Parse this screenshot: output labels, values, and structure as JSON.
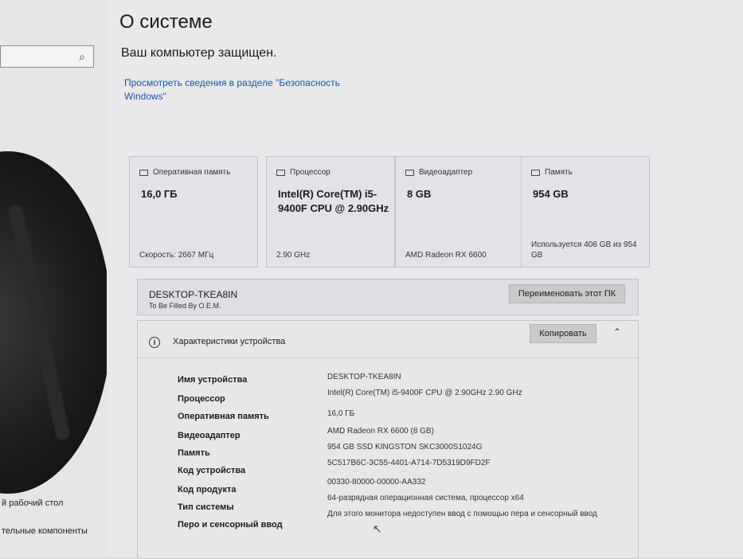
{
  "sidebar": {
    "items": [
      {
        "label": "й рабочий стол"
      },
      {
        "label": "тельные компоненты"
      }
    ]
  },
  "page": {
    "title": "О системе",
    "protected": "Ваш компьютер защищен.",
    "security_link": "Просмотреть сведения в разделе \"Безопасность Windows\""
  },
  "cards": [
    {
      "header": "Оперативная память",
      "value": "16,0 ГБ",
      "footer": "Скорость: 2667 МГц",
      "icon": "ram-icon"
    },
    {
      "header": "Процессор",
      "value": "Intel(R) Core(TM) i5-9400F CPU @ 2.90GHz",
      "footer": "2.90 GHz",
      "icon": "cpu-icon"
    },
    {
      "header": "Видеоадаптер",
      "value": "8 GB",
      "footer": "AMD Radeon RX 6600",
      "icon": "gpu-icon"
    },
    {
      "header": "Память",
      "value": "954 GB",
      "footer": "Используется 406 GB из 954 GB",
      "icon": "storage-icon"
    }
  ],
  "pc": {
    "name": "DESKTOP-TKEA8IN",
    "subtitle": "To Be Filled By O.E.M.",
    "rename_label": "Переименовать этот ПК"
  },
  "specs": {
    "title": "Характеристики устройства",
    "copy_label": "Копировать",
    "rows": [
      {
        "label": "Имя устройства",
        "value": "DESKTOP-TKEA8IN"
      },
      {
        "label": "Процессор",
        "value": "Intel(R) Core(TM) i5-9400F CPU @ 2.90GHz   2.90 GHz"
      },
      {
        "label": "Оперативная память",
        "value": "16,0 ГБ"
      },
      {
        "label": "Видеоадаптер",
        "value": "AMD Radeon RX 6600 (8 GB)"
      },
      {
        "label": "Память",
        "value": "954 GB SSD KINGSTON SKC3000S1024G"
      },
      {
        "label": "Код устройства",
        "value": "5C517B6C-3C55-4401-A714-7D5319D9FD2F"
      },
      {
        "label": "Код продукта",
        "value": "00330-80000-00000-AA332"
      },
      {
        "label": "Тип системы",
        "value": "64-разрядная операционная система, процессор x64"
      },
      {
        "label": "Перо и сенсорный ввод",
        "value": "Для этого монитора недоступен ввод с помощью пера и сенсорный ввод"
      }
    ]
  }
}
